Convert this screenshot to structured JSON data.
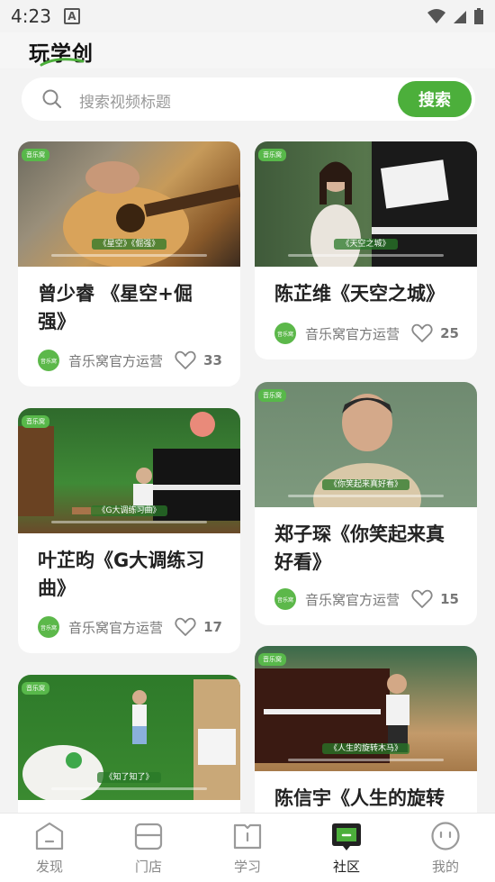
{
  "status_bar": {
    "time": "4:23",
    "indicator": "A"
  },
  "header": {
    "title": "玩学创"
  },
  "search": {
    "placeholder": "搜索视频标题",
    "button": "搜索"
  },
  "cards": [
    {
      "title_line1": "曾少睿 《星空+倔",
      "title_line2": "强》",
      "caption": "《星空》《倔强》",
      "author": "音乐窝官方运营",
      "likes": "33",
      "badge": "音乐窝",
      "avatar_text": "音乐窝"
    },
    {
      "title_line1": "陈芷维《天空之城》",
      "title_line2": "",
      "caption": "《天空之城》",
      "author": "音乐窝官方运营",
      "likes": "25",
      "badge": "音乐窝",
      "avatar_text": "音乐窝"
    },
    {
      "title_line1": "叶芷昀《G大调练习",
      "title_line2": "曲》",
      "caption": "《G大调练习曲》",
      "author": "音乐窝官方运营",
      "likes": "17",
      "badge": "音乐窝",
      "avatar_text": "音乐窝"
    },
    {
      "title_line1": "郑子琛《你笑起来真",
      "title_line2": "好看》",
      "caption": "《你笑起来真好看》",
      "author": "音乐窝官方运营",
      "likes": "15",
      "badge": "音乐窝",
      "avatar_text": "音乐窝"
    },
    {
      "title_line1": "",
      "title_line2": "",
      "caption": "《知了知了》",
      "author": "",
      "likes": "",
      "badge": "音乐窝",
      "avatar_text": ""
    },
    {
      "title_line1": "陈信宇《人生的旋转",
      "title_line2": "",
      "caption": "《人生的旋转木马》",
      "author": "",
      "likes": "",
      "badge": "音乐窝",
      "avatar_text": ""
    }
  ],
  "tabs": [
    {
      "label": "发现",
      "icon": "home-icon"
    },
    {
      "label": "门店",
      "icon": "store-icon"
    },
    {
      "label": "学习",
      "icon": "book-icon"
    },
    {
      "label": "社区",
      "icon": "community-icon",
      "active": true
    },
    {
      "label": "我的",
      "icon": "profile-icon"
    }
  ],
  "colors": {
    "accent": "#4caf3b",
    "background": "#f3f3f3"
  }
}
